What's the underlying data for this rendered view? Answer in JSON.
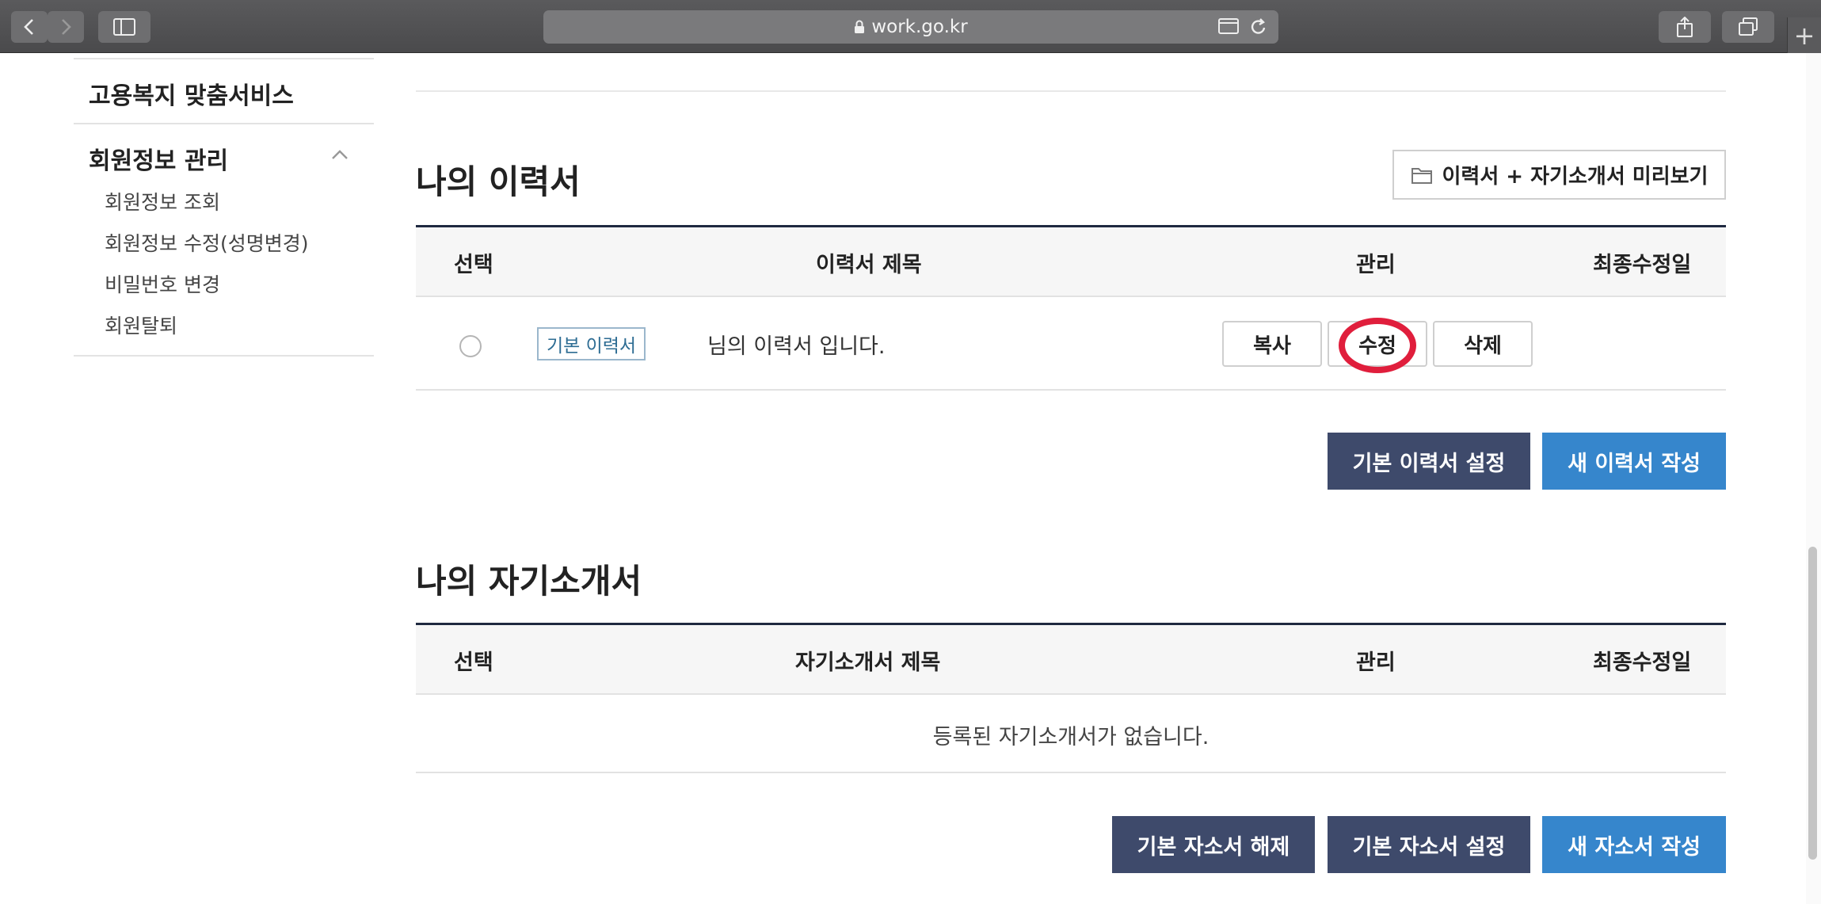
{
  "browser": {
    "url": "work.go.kr"
  },
  "sidebar": {
    "title": "고용복지 맞춤서비스",
    "section": "회원정보 관리",
    "items": [
      {
        "label": "회원정보 조회"
      },
      {
        "label": "회원정보 수정(성명변경)"
      },
      {
        "label": "비밀번호 변경"
      },
      {
        "label": "회원탈퇴"
      }
    ]
  },
  "resume": {
    "heading": "나의 이력서",
    "preview_label": "이력서 + 자기소개서 미리보기",
    "columns": {
      "select": "선택",
      "title": "이력서 제목",
      "manage": "관리",
      "updated": "최종수정일"
    },
    "rows": [
      {
        "tag": "기본 이력서",
        "title": "님의 이력서 입니다.",
        "copy": "복사",
        "edit": "수정",
        "delete": "삭제",
        "updated": ""
      }
    ],
    "set_default_label": "기본 이력서 설정",
    "new_label": "새 이력서 작성"
  },
  "intro": {
    "heading": "나의 자기소개서",
    "columns": {
      "select": "선택",
      "title": "자기소개서 제목",
      "manage": "관리",
      "updated": "최종수정일"
    },
    "empty_message": "등록된 자기소개서가 없습니다.",
    "unset_default_label": "기본 자소서 해제",
    "set_default_label": "기본 자소서 설정",
    "new_label": "새 자소서 작성"
  },
  "colors": {
    "navy": "#1f2940",
    "dark_button": "#3e4a6b",
    "blue_button": "#3686cc",
    "highlight": "#e01e3c"
  }
}
